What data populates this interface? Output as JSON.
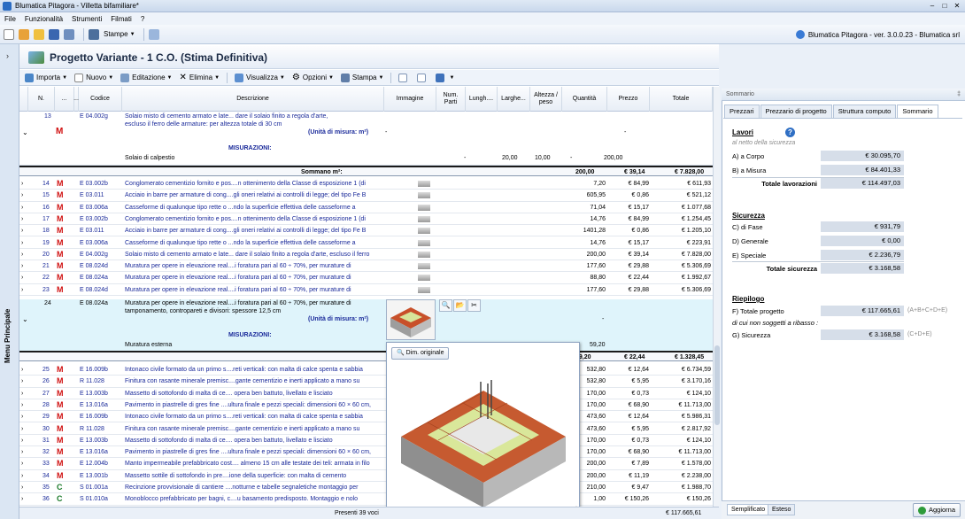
{
  "window": {
    "title": "Blumatica Pitagora - Villetta bifamiliare*",
    "min": "–",
    "max": "□",
    "close": "✕"
  },
  "menu": [
    "File",
    "Funzionalità",
    "Strumenti",
    "Filmati",
    "?"
  ],
  "quickbar": {
    "print_label": "Stampe",
    "brand": "Blumatica Pitagora - ver. 3.0.0.23 - Blumatica srl"
  },
  "sidebar": {
    "label": "Menu Principale"
  },
  "project": {
    "title": "Progetto Variante - 1 C.O. (Stima Definitiva)"
  },
  "toolbar": {
    "importa": "Importa",
    "nuovo": "Nuovo",
    "editazione": "Editazione",
    "elimina": "Elimina",
    "visualizza": "Visualizza",
    "opzioni": "Opzioni",
    "stampa": "Stampa"
  },
  "columns": {
    "n": "N.",
    "dots": "...",
    "dots2": "...",
    "codice": "Codice",
    "descrizione": "Descrizione",
    "immagine": "Immagine",
    "num_parti": "Num. Parti",
    "lunghezza": "Lungh....",
    "larghezza": "Larghe...",
    "altezza": "Altezza / peso",
    "quantita": "Quantità",
    "prezzo": "Prezzo",
    "totale": "Totale"
  },
  "row13": {
    "n": "13",
    "m": "M",
    "code": "E 04.002g",
    "desc1": "Solaio misto di cemento armato e late... dare il solaio finito a regola d'arte,",
    "desc2": "escluso il ferro delle armature: per altezza totale di 30 cm",
    "unit": "(Unità di misura: m²)",
    "dash1": "-",
    "dash2": "-",
    "misure": "MISURAZIONI:",
    "sub": "Solaio di calpestio",
    "sub_np": "-",
    "sub_lu": "20,00",
    "sub_la": "10,00",
    "sub_al": "-",
    "sub_q": "200,00",
    "sum_label": "Sommano m²:",
    "sum_q": "200,00",
    "sum_p": "€ 39,14",
    "sum_t": "€ 7.828,00"
  },
  "rows_a": [
    {
      "n": "14",
      "code": "E 03.002b",
      "desc": "Conglomerato cementizio fornito e pos....n ottenimento della Classe di esposizione 1 (di",
      "q": "7,20",
      "p": "€ 84,99",
      "t": "€ 611,93"
    },
    {
      "n": "15",
      "code": "E 03.011",
      "desc": "Acciaio in barre per armature di cong....gli oneri relativi ai controlli di legge; del tipo Fe B",
      "q": "605,95",
      "p": "€ 0,86",
      "t": "€ 521,12"
    },
    {
      "n": "16",
      "code": "E 03.006a",
      "desc": "Casseforme di qualunque tipo rette o ...ndo la superficie effettiva delle casseforme a",
      "q": "71,04",
      "p": "€ 15,17",
      "t": "€ 1.077,68"
    },
    {
      "n": "17",
      "code": "E 03.002b",
      "desc": "Conglomerato cementizio fornito e pos....n ottenimento della Classe di esposizione 1 (di",
      "q": "14,76",
      "p": "€ 84,99",
      "t": "€ 1.254,45"
    },
    {
      "n": "18",
      "code": "E 03.011",
      "desc": "Acciaio in barre per armature di cong....gli oneri relativi ai controlli di legge; del tipo Fe B",
      "q": "1401,28",
      "p": "€ 0,86",
      "t": "€ 1.205,10"
    },
    {
      "n": "19",
      "code": "E 03.006a",
      "desc": "Casseforme di qualunque tipo rette o ...ndo la superficie effettiva delle casseforme a",
      "q": "14,76",
      "p": "€ 15,17",
      "t": "€ 223,91"
    },
    {
      "n": "20",
      "code": "E 04.002g",
      "desc": "Solaio misto di cemento armato e late... dare il solaio finito a regola d'arte, escluso il ferro",
      "q": "200,00",
      "p": "€ 39,14",
      "t": "€ 7.828,00"
    },
    {
      "n": "21",
      "code": "E 08.024d",
      "desc": "Muratura per opere in elevazione real....i foratura pari al 60 ÷ 70%, per murature di",
      "q": "177,60",
      "p": "€ 29,88",
      "t": "€ 5.306,69"
    },
    {
      "n": "22",
      "code": "E 08.024a",
      "desc": "Muratura per opere in elevazione real....i foratura pari al 60 ÷ 70%, per murature di",
      "q": "88,80",
      "p": "€ 22,44",
      "t": "€ 1.992,67"
    },
    {
      "n": "23",
      "code": "E 08.024d",
      "desc": "Muratura per opere in elevazione real....i foratura pari al 60 ÷ 70%, per murature di",
      "q": "177,60",
      "p": "€ 29,88",
      "t": "€ 5.306,69"
    }
  ],
  "row24": {
    "n": "24",
    "code": "E 08.024a",
    "desc1": "Muratura per opere in elevazione real....i foratura pari al 60 ÷ 70%, per murature di",
    "desc2": "tamponamento, contropareti e divisori: spessore 12,5 cm",
    "unit": "(Unità di misura: m²)",
    "dash1": "-",
    "misure": "MISURAZIONI:",
    "sub": "Muratura esterna",
    "sub_q": "59,20",
    "sum_q": "59,20",
    "sum_p": "€ 22,44",
    "sum_t": "€ 1.328,45",
    "zoom_icon": "🔍",
    "folder_icon": "📂",
    "cut_icon": "✂"
  },
  "rows_b": [
    {
      "n": "25",
      "m": "M",
      "code": "E 16.009b",
      "desc": "Intonaco civile formato da un primo s....reti verticali: con malta di calce spenta e sabbia",
      "q": "532,80",
      "p": "€ 12,64",
      "t": "€ 6.734,59"
    },
    {
      "n": "26",
      "m": "M",
      "code": "R 11.028",
      "desc": "Finitura con rasante minerale premisc....gante cementizio e inerti applicato a mano su",
      "q": "532,80",
      "p": "€ 5,95",
      "t": "€ 3.170,16"
    },
    {
      "n": "27",
      "m": "M",
      "code": "E 13.003b",
      "desc": "Massetto di sottofondo di malta di ce.... opera ben battuto, livellato e lisciato",
      "q": "170,00",
      "p": "€ 0,73",
      "t": "€ 124,10"
    },
    {
      "n": "28",
      "m": "M",
      "code": "E 13.016a",
      "desc": "Pavimento in piastrelle di gres fine ....ultura finale e pezzi speciali: dimensioni 60 × 60 cm,",
      "q": "170,00",
      "p": "€ 68,90",
      "t": "€ 11.713,00"
    },
    {
      "n": "29",
      "m": "M",
      "code": "E 16.009b",
      "desc": "Intonaco civile formato da un primo s....reti verticali: con malta di calce spenta e sabbia",
      "q": "473,60",
      "p": "€ 12,64",
      "t": "€ 5.986,31"
    },
    {
      "n": "30",
      "m": "M",
      "code": "R 11.028",
      "desc": "Finitura con rasante minerale premisc....gante cementizio e inerti applicato a mano su",
      "q": "473,60",
      "p": "€ 5,95",
      "t": "€ 2.817,92"
    },
    {
      "n": "31",
      "m": "M",
      "code": "E 13.003b",
      "desc": "Massetto di sottofondo di malta di ce.... opera ben battuto, livellato e lisciato",
      "q": "170,00",
      "p": "€ 0,73",
      "t": "€ 124,10"
    },
    {
      "n": "32",
      "m": "M",
      "code": "E 13.016a",
      "desc": "Pavimento in piastrelle di gres fine ....ultura finale e pezzi speciali: dimensioni 60 × 60 cm,",
      "q": "170,00",
      "p": "€ 68,90",
      "t": "€ 11.713,00"
    },
    {
      "n": "33",
      "m": "M",
      "code": "E 12.004b",
      "desc": "Manto impermeabile prefabbricato cost.... almeno 15 cm alle testate dei teli: armata in filo",
      "q": "200,00",
      "p": "€ 7,89",
      "t": "€ 1.578,00"
    },
    {
      "n": "34",
      "m": "M",
      "code": "E 13.001b",
      "desc": "Massetto sottile di sottofondo in pre....ione della superficie: con malta di cemento",
      "q": "200,00",
      "p": "€ 11,19",
      "t": "€ 2.238,00"
    },
    {
      "n": "35",
      "m": "C",
      "code": "S 01.001a",
      "desc": "Recinzione provvisionale di cantiere ....notturne e tabelle segnaletiche  montaggio per",
      "q": "210,00",
      "p": "€ 9,47",
      "t": "€ 1.988,70"
    },
    {
      "n": "36",
      "m": "C",
      "code": "S 01.010a",
      "desc": "Monoblocco prefabbricato per bagni, c....u basamento predisposto. Montaggio e nolo",
      "q": "1,00",
      "p": "€ 150,26",
      "t": "€ 150,26"
    }
  ],
  "popup": {
    "dim_label": "Dim. originale"
  },
  "status": {
    "count": "Presenti 39 voci",
    "total": "€ 117.665,61"
  },
  "rpanel": {
    "title": "Sommario",
    "pin": "‡",
    "tabs": [
      "Prezzari",
      "Prezzario di progetto",
      "Struttura computo",
      "Sommario"
    ],
    "lavori": {
      "h": "Lavori",
      "note": "al netto della sicurezza",
      "a_l": "A) a Corpo",
      "a_v": "€ 30.095,70",
      "b_l": "B) a Misura",
      "b_v": "€ 84.401,33",
      "tot_l": "Totale lavorazioni",
      "tot_v": "€ 114.497,03"
    },
    "sicurezza": {
      "h": "Sicurezza",
      "c_l": "C) di Fase",
      "c_v": "€ 931,79",
      "d_l": "D) Generale",
      "d_v": "€ 0,00",
      "e_l": "E) Speciale",
      "e_v": "€ 2.236,79",
      "tot_l": "Totale sicurezza",
      "tot_v": "€ 3.168,58"
    },
    "riepilogo": {
      "h": "Riepilogo",
      "f_l": "F) Totale progetto",
      "f_v": "€ 117.665,61",
      "f_n": "(A+B+C+D+E)",
      "note": "di cui non soggetti a ribasso :",
      "g_l": "G) Sicurezza",
      "g_v": "€ 3.168,58",
      "g_n": "(C+D+E)"
    },
    "bottom_tabs": [
      "Semplificato",
      "Esteso"
    ],
    "aggiorna": "Aggiorna"
  }
}
